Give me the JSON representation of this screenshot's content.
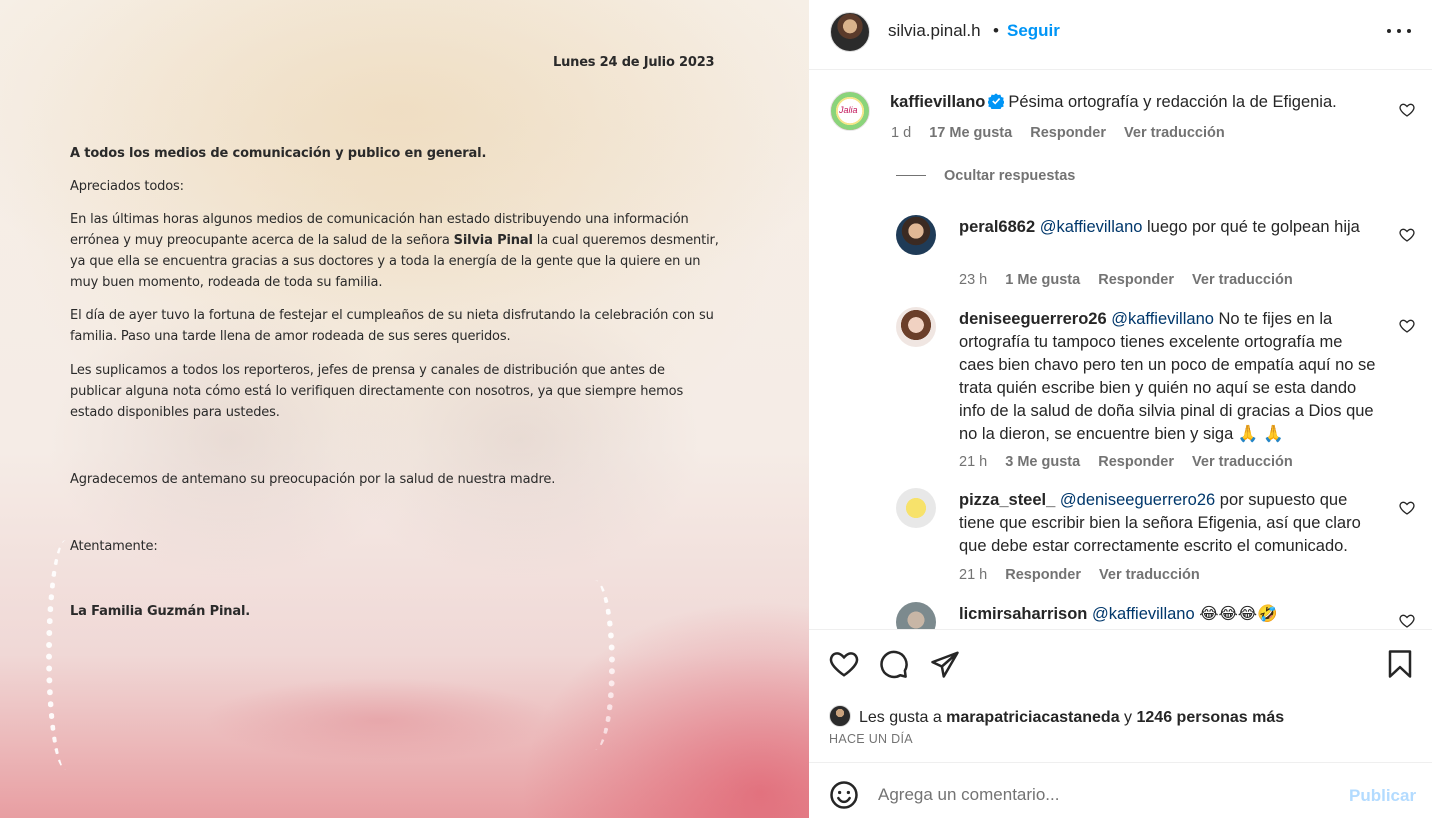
{
  "letter": {
    "date": "Lunes 24 de Julio 2023",
    "heading": "A todos los medios de comunicación y publico en general.",
    "greeting": "Apreciados todos:",
    "p1_before": "En las últimas horas algunos medios de comunicación han estado distribuyendo una información errónea y muy preocupante acerca de la salud de la señora ",
    "p1_bold": "Silvia Pinal",
    "p1_after": " la cual queremos desmentir, ya que ella se encuentra gracias a sus doctores y a toda la energía de la gente que la quiere en un muy buen momento, rodeada de toda su familia.",
    "p2": " El día de ayer tuvo la fortuna de festejar el cumpleaños de su nieta disfrutando la celebración con su familia. Paso una tarde llena de amor rodeada de sus seres queridos.",
    "p3": "Les suplicamos a todos los reporteros, jefes de prensa y canales de distribución que antes de publicar alguna nota cómo está lo verifiquen directamente con nosotros, ya que siempre hemos estado disponibles para ustedes.",
    "thanks": "Agradecemos de antemano su preocupación por la salud de nuestra madre.",
    "signoff": "Atentamente:",
    "family": "La Familia Guzmán Pinal."
  },
  "header": {
    "username": "silvia.pinal.h",
    "separator": "•",
    "follow_label": "Seguir"
  },
  "main_comment": {
    "avatar_text": "Jalia",
    "user": "kaffievillano",
    "text": "Pésima ortografía y redacción la de Efigenia.",
    "time": "1 d",
    "likes": "17 Me gusta",
    "reply": "Responder",
    "translate": "Ver traducción"
  },
  "hide_replies_label": "Ocultar respuestas",
  "replies": [
    {
      "user": "peral6862",
      "mention": "@kaffievillano",
      "text": " luego por qué te golpean hija",
      "time": "23 h",
      "likes": "1 Me gusta",
      "reply": "Responder",
      "translate": "Ver traducción"
    },
    {
      "user": "deniseeguerrero26",
      "mention": "@kaffievillano",
      "text": " No te fijes en la ortografía tu tampoco tienes excelente ortografía me caes bien chavo pero ten un poco de empatía aquí no se trata quién escribe bien y quién no aquí se esta dando info de la salud de doña silvia pinal di gracias a Dios que no la dieron, se encuentre bien y siga 🙏 🙏",
      "time": "21 h",
      "likes": "3 Me gusta",
      "reply": "Responder",
      "translate": "Ver traducción"
    },
    {
      "user": "pizza_steel_",
      "mention": "@deniseeguerrero26",
      "text": " por supuesto que tiene que escribir bien la señora Efigenia, así que claro que debe estar correctamente escrito el comunicado.",
      "time": "21 h",
      "reply": "Responder",
      "translate": "Ver traducción"
    },
    {
      "user": "licmirsaharrison",
      "mention": "@kaffievillano",
      "text": " 😂😂😂🤣"
    }
  ],
  "likes_summary": {
    "prefix": "Les gusta a ",
    "user": "marapatriciacastaneda",
    "middle": " y ",
    "others": "1246 personas más"
  },
  "time_ago": "HACE UN DÍA",
  "comment_box": {
    "placeholder": "Agrega un comentario...",
    "publish_label": "Publicar"
  },
  "colors": {
    "accent": "#0095f6",
    "verified": "#0095f6",
    "mention": "#00376b",
    "publish_disabled": "#b3dbff"
  },
  "icons": [
    "heart-icon",
    "comment-icon",
    "share-icon",
    "bookmark-icon",
    "emoji-icon",
    "more-icon",
    "verified-icon"
  ]
}
